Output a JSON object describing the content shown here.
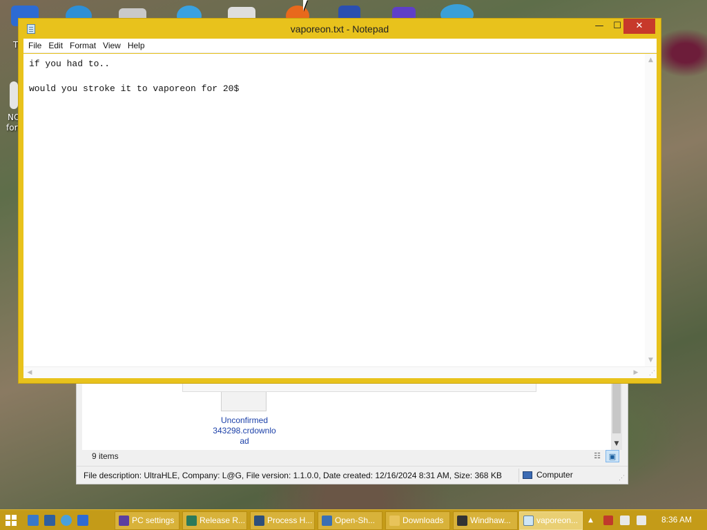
{
  "notepad": {
    "title": "vaporeon.txt - Notepad",
    "controls": {
      "minimize": "—",
      "maximize": "☐",
      "close": "✕"
    },
    "menu": [
      "File",
      "Edit",
      "Format",
      "View",
      "Help"
    ],
    "content": "if you had to..\n\nwould you stroke it to vaporeon for 20$"
  },
  "explorer": {
    "file_name_lines": [
      "Unconfirmed",
      "343298.crdownlo",
      "ad"
    ],
    "items_count": "9 items",
    "status_description": "File description: UltraHLE, Company: L@G, File version: 1.1.0.0, Date created: 12/16/2024 8:31 AM, Size: 368 KB",
    "status_zone": "Computer"
  },
  "desktop": {
    "icon_labels": [
      "T",
      "NO",
      "for"
    ]
  },
  "taskbar": {
    "buttons": [
      {
        "label": "PC settings",
        "icon": "gear-icon",
        "color": "#5b3fa0"
      },
      {
        "label": "Release R...",
        "icon": "release-icon",
        "color": "#2c7a5a"
      },
      {
        "label": "Process H...",
        "icon": "process-hacker-icon",
        "color": "#2e4f7a"
      },
      {
        "label": "Open-Sh...",
        "icon": "open-shell-icon",
        "color": "#3b6fb3"
      },
      {
        "label": "Downloads",
        "icon": "folder-icon",
        "color": "#e8c35a"
      },
      {
        "label": "Windhaw...",
        "icon": "windhawk-icon",
        "color": "#333333"
      },
      {
        "label": "vaporeon...",
        "icon": "notepad-icon",
        "color": "#cfe6f5"
      }
    ],
    "clock": "8:36 AM",
    "tray_up_arrow": "▲",
    "accent": "#c49b18"
  }
}
